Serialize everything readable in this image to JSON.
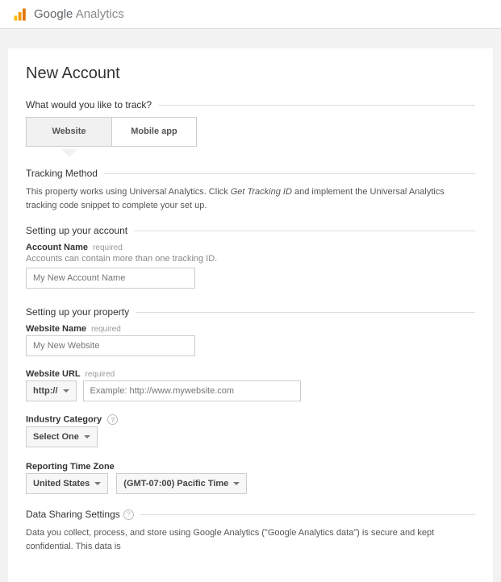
{
  "header": {
    "brand_strong": "Google",
    "brand_light": " Analytics"
  },
  "page": {
    "title": "New Account",
    "track_question": "What would you like to track?",
    "toggle": {
      "website": "Website",
      "mobile": "Mobile app"
    },
    "tracking_method": {
      "label": "Tracking Method",
      "desc_a": "This property works using Universal Analytics. Click ",
      "desc_em": "Get Tracking ID",
      "desc_b": " and implement the Universal Analytics tracking code snippet to complete your set up."
    },
    "account_setup": {
      "label": "Setting up your account",
      "field_label": "Account Name",
      "required": "required",
      "hint": "Accounts can contain more than one tracking ID.",
      "placeholder": "My New Account Name"
    },
    "property_setup": {
      "label": "Setting up your property",
      "website_name_label": "Website Name",
      "website_name_placeholder": "My New Website",
      "website_url_label": "Website URL",
      "protocol_value": "http://",
      "url_placeholder": "Example: http://www.mywebsite.com",
      "industry_label": "Industry Category",
      "industry_value": "Select One",
      "tz_label": "Reporting Time Zone",
      "tz_country": "United States",
      "tz_value": "(GMT-07:00) Pacific Time",
      "required": "required"
    },
    "data_sharing": {
      "label": "Data Sharing Settings",
      "desc": "Data you collect, process, and store using Google Analytics (\"Google Analytics data\") is secure and kept confidential. This data is"
    }
  }
}
